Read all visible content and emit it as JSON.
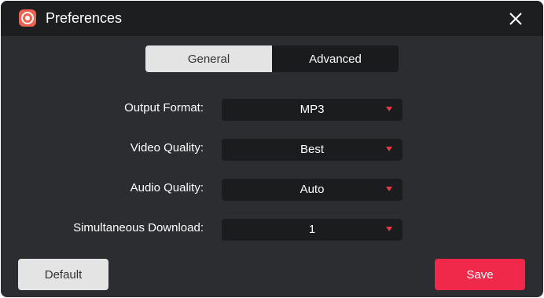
{
  "window": {
    "title": "Preferences",
    "app_icon": "app-logo-icon",
    "close_icon": "close-icon"
  },
  "tabs": [
    {
      "label": "General",
      "active": true
    },
    {
      "label": "Advanced",
      "active": false
    }
  ],
  "settings": [
    {
      "label": "Output Format:",
      "value": "MP3"
    },
    {
      "label": "Video Quality:",
      "value": "Best"
    },
    {
      "label": "Audio Quality:",
      "value": "Auto"
    },
    {
      "label": "Simultaneous Download:",
      "value": "1"
    }
  ],
  "buttons": {
    "default_label": "Default",
    "save_label": "Save"
  },
  "colors": {
    "accent": "#f0284a",
    "caret": "#e8374a",
    "background": "#2b2d30"
  }
}
